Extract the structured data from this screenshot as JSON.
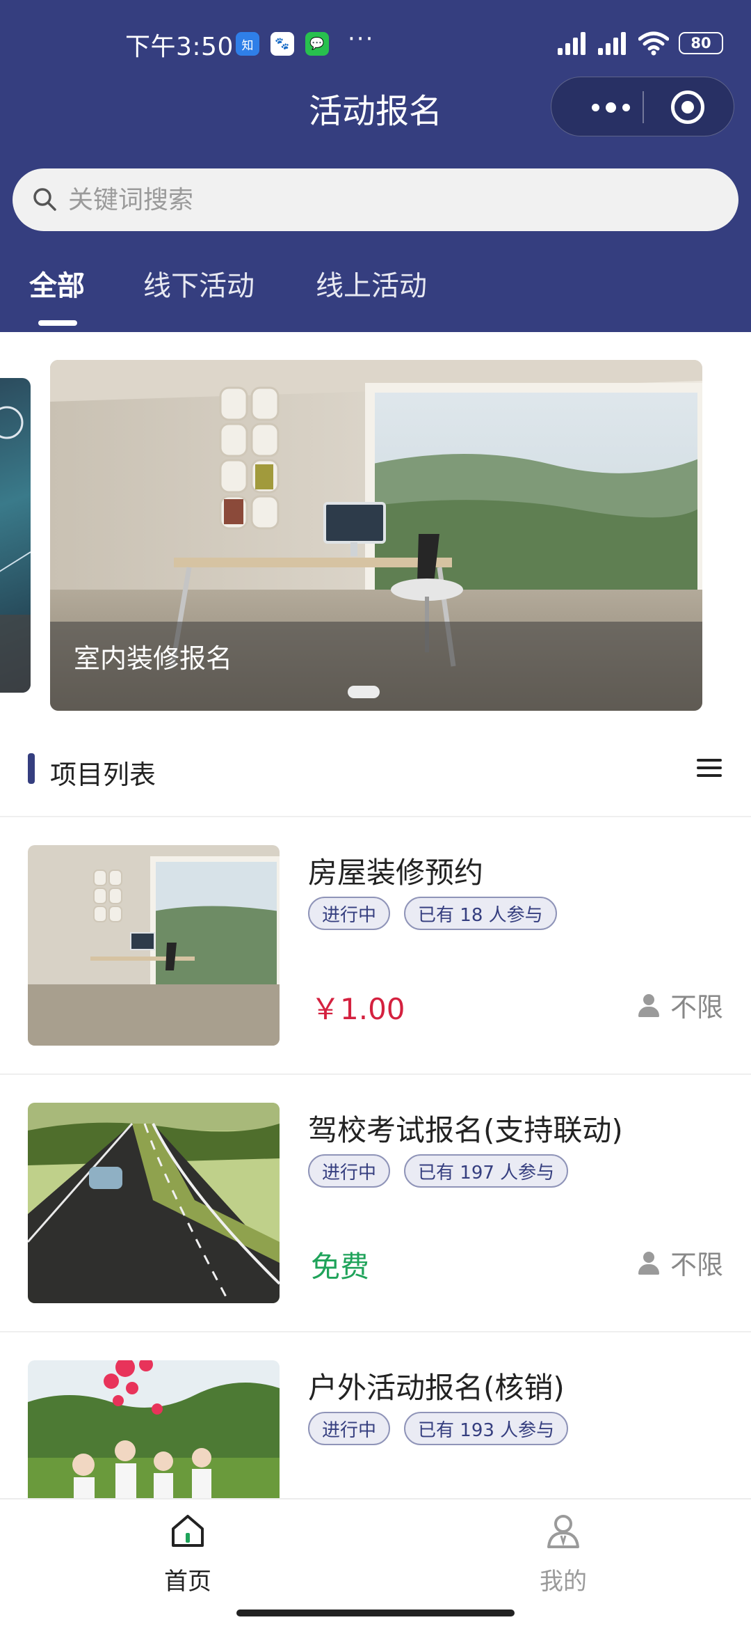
{
  "status_bar": {
    "time": "下午3:50",
    "badge_zhihu": "知",
    "badge_baidu": "🐾",
    "badge_wechat": "💬",
    "dots": "···",
    "battery": "80"
  },
  "nav": {
    "title": "活动报名"
  },
  "search": {
    "placeholder": "关键词搜索"
  },
  "tabs": [
    {
      "label": "全部",
      "active": true
    },
    {
      "label": "线下活动",
      "active": false
    },
    {
      "label": "线上活动",
      "active": false
    }
  ],
  "banner": {
    "caption": "室内装修报名"
  },
  "section": {
    "title": "项目列表"
  },
  "items": [
    {
      "title": "房屋装修预约",
      "status": "进行中",
      "participants": "已有 18 人参与",
      "price": "￥1.00",
      "quota": "不限"
    },
    {
      "title": "驾校考试报名(支持联动)",
      "status": "进行中",
      "participants": "已有 197 人参与",
      "price": "免费",
      "quota": "不限"
    },
    {
      "title": "户外活动报名(核销)",
      "status": "进行中",
      "participants": "已有 193 人参与"
    }
  ],
  "tabbar": [
    {
      "label": "首页",
      "icon": "home-icon",
      "active": true
    },
    {
      "label": "我的",
      "icon": "user-icon",
      "active": false
    }
  ],
  "colors": {
    "primary": "#353e7f",
    "price": "#d4213f",
    "free": "#1fa35a"
  }
}
